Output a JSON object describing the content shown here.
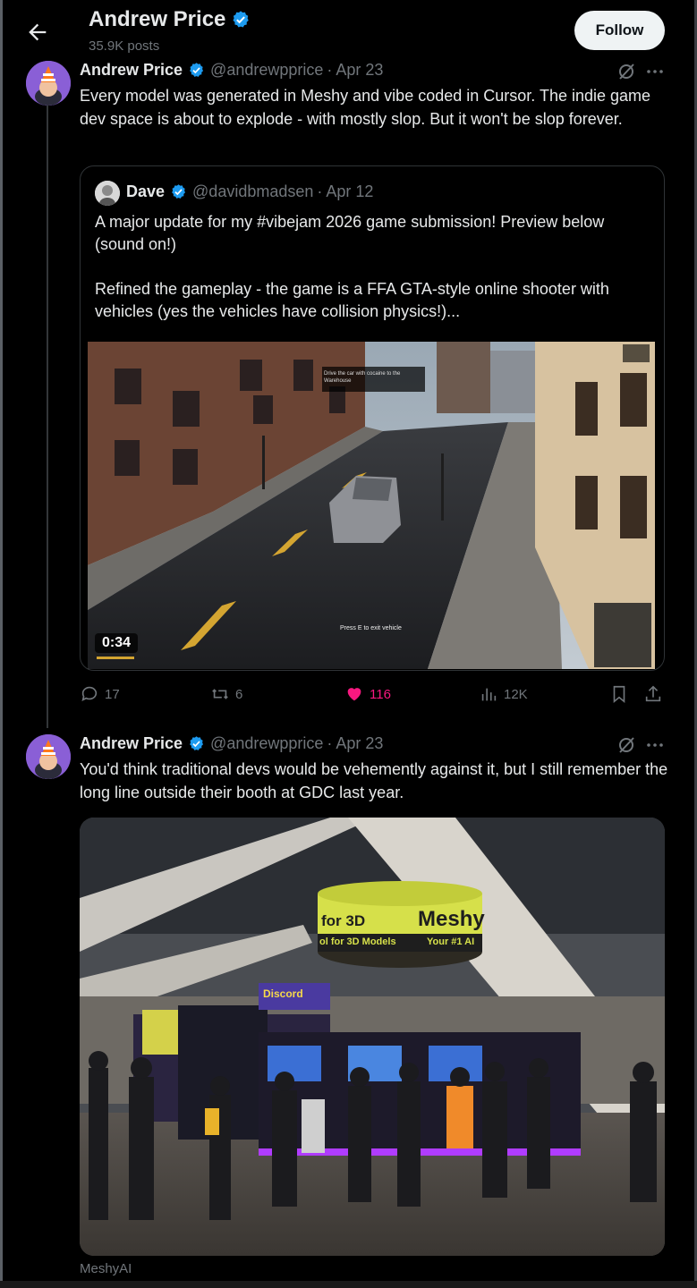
{
  "header": {
    "name": "Andrew Price",
    "posts": "35.9K posts",
    "follow_label": "Follow"
  },
  "tweet1": {
    "name": "Andrew Price",
    "handle": "@andrewpprice",
    "date": "· Apr 23",
    "text": "Every model was generated in Meshy and vibe coded in Cursor. The indie game dev space is about to explode - with mostly slop. But it won't be slop forever."
  },
  "quote": {
    "name": "Dave",
    "handle": "@davidbmadsen",
    "date": "· Apr 12",
    "text1": "A major update for my #vibejam 2026 game submission! Preview below (sound on!)",
    "text2": "Refined the gameplay - the game is a FFA GTA-style online shooter with vehicles (yes the vehicles have collision physics!)...",
    "video_time": "0:34",
    "video_hint": "Press E to exit vehicle",
    "video_mission": "Drive the car with cocaine to the Warehouse"
  },
  "actions": {
    "replies": "17",
    "reposts": "6",
    "likes": "116",
    "views": "12K"
  },
  "tweet2": {
    "name": "Andrew Price",
    "handle": "@andrewpprice",
    "date": "· Apr 23",
    "text": "You'd think traditional devs would be vehemently against it, but I still remember the long line outside their booth at GDC last year.",
    "sign_left": "for 3D",
    "sign_brand": "Meshy",
    "sign_bottom": "ol for 3D Models",
    "sign_right": "Your #1 AI",
    "discord": "Discord",
    "credit": "MeshyAI"
  },
  "colors": {
    "background": "#000000",
    "text": "#e7e9ea",
    "muted": "#71767b",
    "verified": "#1d9bf0",
    "like": "#f91880",
    "border": "#2f3336"
  }
}
